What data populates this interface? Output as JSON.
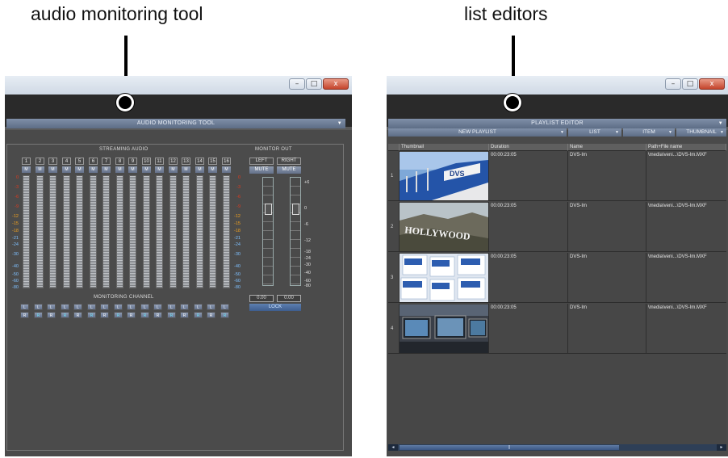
{
  "callouts": {
    "left": "audio monitoring tool",
    "right": "list editors"
  },
  "window_buttons": {
    "minimize": "–",
    "maximize": "□",
    "close": "x"
  },
  "audio_tool": {
    "title": "AUDIO MONITORING TOOL",
    "streaming_label": "STREAMING AUDIO",
    "monitor_out_label": "MONITOR OUT",
    "monitoring_channel_label": "MONITORING CHANNEL",
    "channels": [
      "1",
      "2",
      "3",
      "4",
      "5",
      "6",
      "7",
      "8",
      "9",
      "10",
      "11",
      "12",
      "13",
      "14",
      "15",
      "16"
    ],
    "mute_label": "M",
    "left_label": "LEFT",
    "right_label": "RIGHT",
    "mute_button": "MUTE",
    "left_value": "0.00",
    "right_value": "0.00",
    "lock_label": "LOCK",
    "l_label": "L",
    "r_label": "R",
    "meter_scale": [
      "0",
      "-3",
      "-6",
      "-9",
      "-12",
      "-15",
      "-18",
      "-21",
      "-24",
      "-30",
      "-40",
      "-50",
      "-60",
      "-80"
    ],
    "meter_scale_colors": [
      "#e03a1e",
      "#e03a1e",
      "#e03a1e",
      "#e03a1e",
      "#f0a020",
      "#f0a020",
      "#f0a020",
      "#7fc0ff",
      "#7fc0ff",
      "#7fc0ff",
      "#7fc0ff",
      "#7fc0ff",
      "#7fc0ff",
      "#7fc0ff"
    ],
    "monitor_scale": [
      "+6",
      "0",
      "-6",
      "-12",
      "-18",
      "-24",
      "-30",
      "-40",
      "-60",
      "-80"
    ]
  },
  "playlist": {
    "title": "PLAYLIST EDITOR",
    "toolbar": {
      "new_playlist": "NEW PLAYLIST",
      "list": "LIST",
      "item": "ITEM",
      "thumbnail": "THUMBNAIL"
    },
    "columns": {
      "thumbnail": "Thumbnail",
      "duration": "Duration",
      "name": "Name",
      "path": "Path+File name"
    },
    "rows": [
      {
        "num": "1",
        "duration": "00:00:23:05",
        "name": "DVS-Im",
        "path": "\\media\\veni...\\DVS-Im.MXF"
      },
      {
        "num": "2",
        "duration": "00:00:23:05",
        "name": "DVS-Im",
        "path": "\\media\\veni...\\DVS-Im.MXF"
      },
      {
        "num": "3",
        "duration": "00:00:23:05",
        "name": "DVS-Im",
        "path": "\\media\\veni...\\DVS-Im.MXF"
      },
      {
        "num": "4",
        "duration": "00:00:23:05",
        "name": "DVS-Im",
        "path": "\\media\\veni...\\DVS-Im.MXF"
      }
    ],
    "thumb_text": {
      "dvs": "DVS",
      "hollywood": "HOLLYWOOD"
    },
    "scroll_grip": "||",
    "scroll_left": "◄",
    "scroll_right": "►"
  }
}
